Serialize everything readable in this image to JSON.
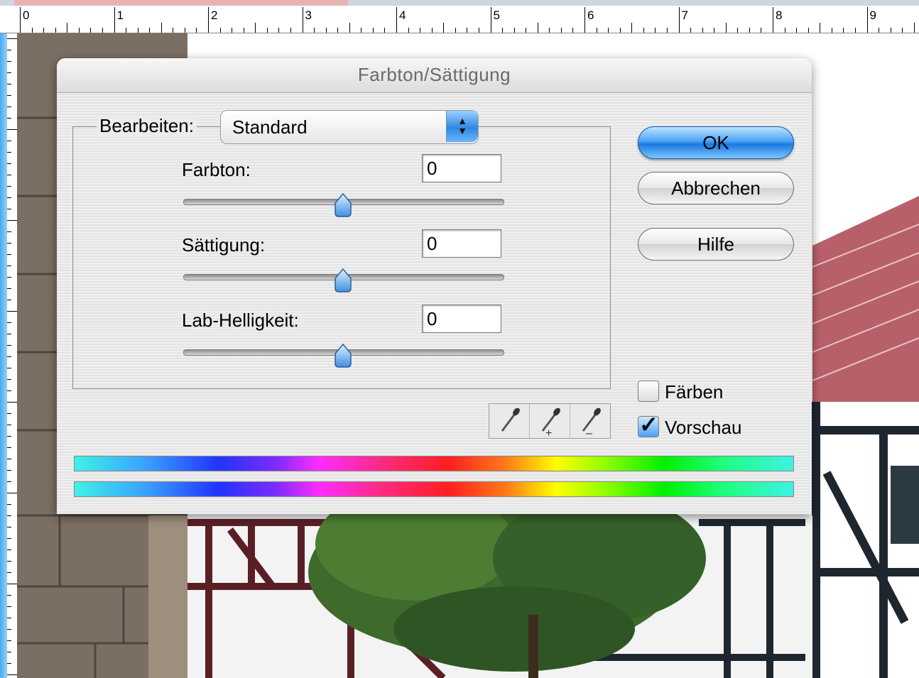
{
  "ruler": {
    "numbers": [
      "0",
      "1",
      "2",
      "3",
      "4",
      "5",
      "6",
      "7",
      "8",
      "9"
    ]
  },
  "dialog": {
    "title": "Farbton/Sättigung",
    "edit_label": "Bearbeiten:",
    "edit_value": "Standard",
    "hue": {
      "label": "Farbton:",
      "value": "0",
      "slider_position": 0.5
    },
    "saturation": {
      "label": "Sättigung:",
      "value": "0",
      "slider_position": 0.5
    },
    "lightness": {
      "label": "Lab-Helligkeit:",
      "value": "0",
      "slider_position": 0.5
    },
    "buttons": {
      "ok": "OK",
      "cancel": "Abbrechen",
      "help": "Hilfe"
    },
    "colorize": {
      "label": "Färben",
      "checked": false
    },
    "preview": {
      "label": "Vorschau",
      "checked": true
    },
    "eyedroppers": [
      "eyedropper-icon",
      "eyedropper-plus-icon",
      "eyedropper-minus-icon"
    ]
  }
}
